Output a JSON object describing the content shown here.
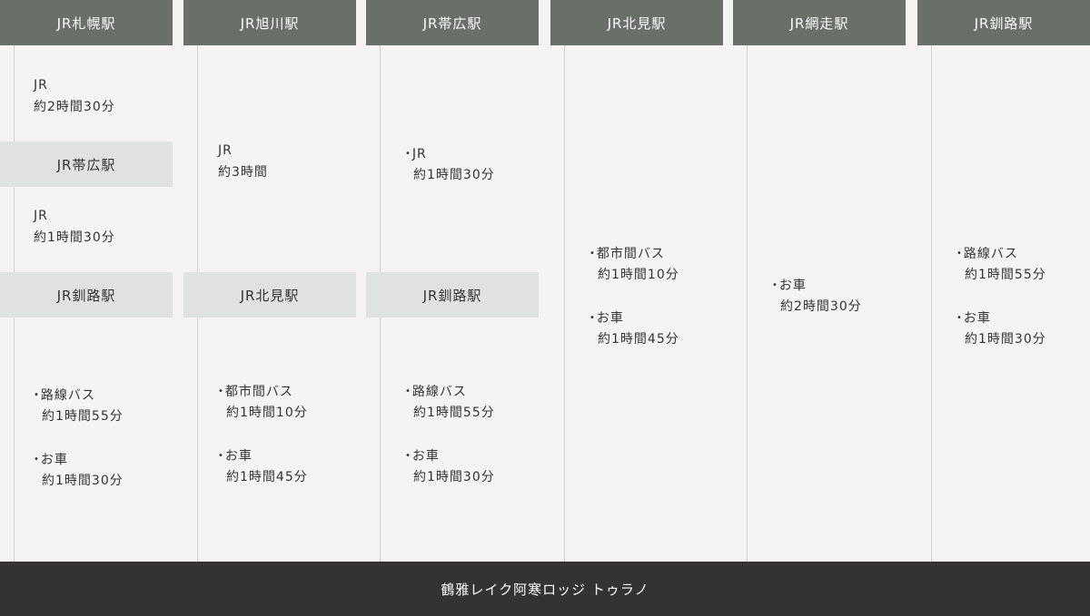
{
  "columns": [
    {
      "header": "JR札幌駅"
    },
    {
      "header": "JR旭川駅"
    },
    {
      "header": "JR帯広駅"
    },
    {
      "header": "JR北見駅"
    },
    {
      "header": "JR網走駅"
    },
    {
      "header": "JR釧路駅"
    }
  ],
  "col1": {
    "leg1": {
      "mode": "JR",
      "time": "約2時間30分"
    },
    "via1": "JR帯広駅",
    "leg2": {
      "mode": "JR",
      "time": "約1時間30分"
    },
    "via2": "JR釧路駅",
    "final": [
      {
        "mode": "路線バス",
        "time": "約1時間55分"
      },
      {
        "mode": "お車",
        "time": "約1時間30分"
      }
    ]
  },
  "col2": {
    "leg1": {
      "mode": "JR",
      "time": "約3時間"
    },
    "via1": "JR北見駅",
    "final": [
      {
        "mode": "都市間バス",
        "time": "約1時間10分"
      },
      {
        "mode": "お車",
        "time": "約1時間45分"
      }
    ]
  },
  "col3": {
    "leg1": {
      "mode": "JR",
      "time": "約1時間30分"
    },
    "via1": "JR釧路駅",
    "final": [
      {
        "mode": "路線バス",
        "time": "約1時間55分"
      },
      {
        "mode": "お車",
        "time": "約1時間30分"
      }
    ]
  },
  "col4": {
    "final": [
      {
        "mode": "都市間バス",
        "time": "約1時間10分"
      },
      {
        "mode": "お車",
        "time": "約1時間45分"
      }
    ]
  },
  "col5": {
    "final": [
      {
        "mode": "お車",
        "time": "約2時間30分"
      }
    ]
  },
  "col6": {
    "final": [
      {
        "mode": "路線バス",
        "time": "約1時間55分"
      },
      {
        "mode": "お車",
        "time": "約1時間30分"
      }
    ]
  },
  "destination": "鶴雅レイク阿寒ロッジ トゥラノ",
  "bullet": "•"
}
